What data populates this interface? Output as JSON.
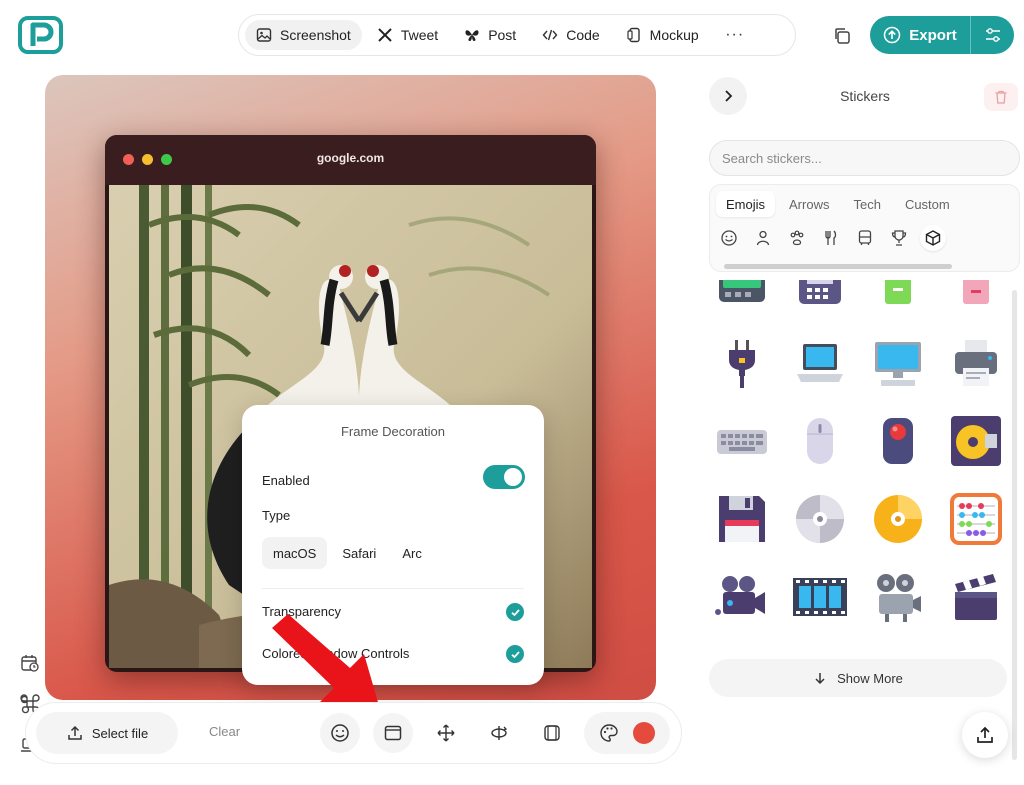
{
  "header": {
    "tabs": [
      {
        "label": "Screenshot",
        "icon": "image-icon",
        "active": true
      },
      {
        "label": "Tweet",
        "icon": "x-logo-icon"
      },
      {
        "label": "Post",
        "icon": "butterfly-icon"
      },
      {
        "label": "Code",
        "icon": "code-icon"
      },
      {
        "label": "Mockup",
        "icon": "phone-icon"
      }
    ],
    "more": "···",
    "export_label": "Export"
  },
  "canvas": {
    "browser_url": "google.com",
    "traffic_lights": [
      "#f25f57",
      "#f6bd2f",
      "#3fc94a"
    ],
    "gradient": [
      "#dcc6bd",
      "#d04d44"
    ]
  },
  "frame_popup": {
    "title": "Frame Decoration",
    "enabled_label": "Enabled",
    "enabled": true,
    "type_label": "Type",
    "types": [
      "macOS",
      "Safari",
      "Arc"
    ],
    "selected_type": "macOS",
    "transparency_label": "Transparency",
    "transparency": true,
    "colored_controls_label": "Colored Window Controls",
    "colored_controls": true
  },
  "bottom_bar": {
    "select_file_label": "Select file",
    "clear_label": "Clear",
    "tools": [
      "smiley-icon",
      "frame-icon",
      "move-icon",
      "rotate-icon",
      "3d-box-icon"
    ],
    "palette_color": "#e54b3c"
  },
  "stickers_panel": {
    "title": "Stickers",
    "search_placeholder": "Search stickers...",
    "category_tabs": [
      "Emojis",
      "Arrows",
      "Tech",
      "Custom"
    ],
    "active_category_tab": "Emojis",
    "category_icons": [
      "smiley-icon",
      "person-icon",
      "paw-icon",
      "utensils-icon",
      "bus-icon",
      "trophy-icon",
      "cube-icon"
    ],
    "show_more_label": "Show More",
    "stickers": [
      "pager",
      "fax-machine",
      "battery-green",
      "battery-pink",
      "electric-plug",
      "laptop",
      "desktop-computer",
      "printer",
      "keyboard",
      "computer-mouse",
      "trackball",
      "minidisc",
      "floppy-disk",
      "optical-disc",
      "dvd",
      "abacus",
      "movie-camera",
      "film-frames",
      "film-projector",
      "clapper-board"
    ]
  },
  "colors": {
    "accent": "#1e9e9a",
    "arrow_annotation": "#e8141a"
  }
}
